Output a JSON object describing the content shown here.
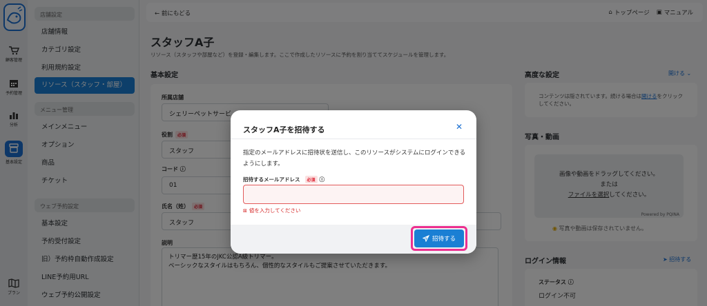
{
  "rail": [
    {
      "label": "顧客管理",
      "icon": "cart-icon"
    },
    {
      "label": "予約管理",
      "icon": "calendar-icon"
    },
    {
      "label": "分析",
      "icon": "chart-icon"
    },
    {
      "label": "基本設定",
      "icon": "store-icon"
    },
    {
      "label": "プラン",
      "icon": "map-icon"
    }
  ],
  "menu": {
    "sec1": "店舗設定",
    "items1": [
      "店舗情報",
      "カテゴリ設定",
      "利用規約設定",
      "リソース（スタッフ・部屋）"
    ],
    "sec2": "メニュー管理",
    "items2": [
      "メインメニュー",
      "オプション",
      "商品",
      "チケット"
    ],
    "sec3": "ウェブ予約設定",
    "items3": [
      "基本設定",
      "予約受付設定",
      "旧）予約枠自動作成設定",
      "LINE予約用URL",
      "ウェブ予約公開設定"
    ]
  },
  "topbar": {
    "back": "前にもどる",
    "top_page": "トップページ",
    "manual": "マニュアル"
  },
  "page": {
    "title": "スタッフA子",
    "desc": "リソース（スタッフや部屋など）を登録・編集します。ここで作成したリソースに予約を割り当ててスケジュールを管理します。",
    "section": "基本設定"
  },
  "form": {
    "store_label": "所属店舗",
    "store_value": "シェリーペットサービ",
    "role_label": "役割",
    "role_value": "スタッフ",
    "code_label": "コード",
    "code_value": "01",
    "name_label": "氏名（姓）",
    "name_value": "スタッフ",
    "required": "必須",
    "desc_label": "説明",
    "desc_value1": "トリマー歴15年のJKC公認A級トリマー。",
    "desc_value2": "ベーシックなスタイルはもちろん、個性的なスタイルもご提案させていただきます。"
  },
  "right": {
    "advanced": "高度な設定",
    "open": "開ける",
    "hidden_pre": "コンテンツは隠されています。続ける場合は",
    "hidden_link": "開ける",
    "hidden_post": "をクリックしてください。",
    "media": "写真・動画",
    "drop1": "画像や動画をドラッグしてください。",
    "drop2": "または",
    "drop3_link": "ファイルを選択",
    "drop3_post": "してください。",
    "powered": "Powered by PQINA",
    "note": "写真や動画は保存されていません。",
    "login": "ログイン情報",
    "invite_link": "招待する",
    "status_label": "ステータス",
    "status_value": "ログイン不可"
  },
  "modal": {
    "title": "スタッフA子を招待する",
    "body": "指定のメールアドレスに招待状を送信し、このリソースがシステムにログインできるようにします。",
    "email_label": "招待するメールアドレス",
    "required": "必須",
    "email_value": "",
    "error": "値を入力してください",
    "submit": "招待する"
  },
  "colors": {
    "accent": "#1a7fd4",
    "highlight": "#ec2f8f",
    "error": "#d62b2b"
  }
}
